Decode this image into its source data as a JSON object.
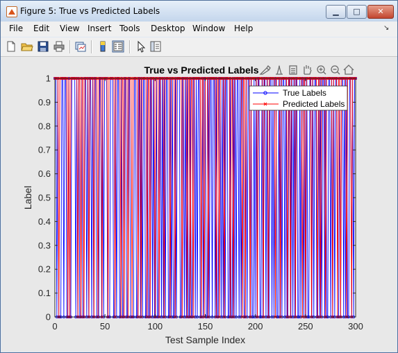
{
  "window": {
    "title": "Figure 5: True vs Predicted Labels",
    "controls": {
      "minimize": "▁",
      "maximize": "□",
      "close": "✕"
    }
  },
  "menu": {
    "items": [
      "File",
      "Edit",
      "View",
      "Insert",
      "Tools",
      "Desktop",
      "Window",
      "Help"
    ],
    "overflow": "↘"
  },
  "toolbar": {
    "icons": [
      "new-figure-icon",
      "open-file-icon",
      "save-icon",
      "print-icon",
      "link-plot-icon",
      "colorbar-icon",
      "legend-icon",
      "pointer-icon",
      "property-inspector-icon"
    ]
  },
  "axes_toolbar": {
    "icons": [
      "brush-icon",
      "data-tip-icon",
      "rotate-icon",
      "pan-icon",
      "zoom-in-icon",
      "zoom-out-icon",
      "home-icon"
    ]
  },
  "colors": {
    "true": "#0000ff",
    "predicted": "#ff0000"
  },
  "chart_data": {
    "type": "line",
    "title": "True vs Predicted Labels",
    "xlabel": "Test Sample Index",
    "ylabel": "Label",
    "xlim": [
      0,
      300
    ],
    "ylim": [
      0,
      1
    ],
    "xticks": [
      "0",
      "50",
      "100",
      "150",
      "200",
      "250",
      "300"
    ],
    "yticks": [
      "0",
      "0.1",
      "0.2",
      "0.3",
      "0.4",
      "0.5",
      "0.6",
      "0.7",
      "0.8",
      "0.9",
      "1"
    ],
    "grid": false,
    "legend_position": "top-right",
    "series": [
      {
        "name": "True Labels",
        "marker": "o",
        "color": "#0000ff",
        "values": [
          1,
          1,
          0,
          1,
          0,
          0,
          0,
          1,
          1,
          0,
          1,
          1,
          0,
          0,
          1,
          0,
          0,
          1,
          1,
          1,
          1,
          0,
          1,
          0,
          1,
          0,
          0,
          1,
          0,
          0,
          1,
          1,
          0,
          1,
          0,
          1,
          1,
          0,
          1,
          0,
          1,
          1,
          0,
          0,
          0,
          1,
          1,
          0,
          1,
          0,
          1,
          1,
          1,
          0,
          0,
          0,
          1,
          1,
          1,
          0,
          0,
          1,
          0,
          1,
          1,
          0,
          0,
          1,
          0,
          0,
          1,
          1,
          0,
          0,
          1,
          1,
          0,
          0,
          0,
          0,
          1,
          1,
          0,
          0,
          1,
          1,
          0,
          1,
          0,
          1,
          1,
          0,
          0,
          1,
          0,
          0,
          1,
          1,
          0,
          1,
          0,
          0,
          1,
          0,
          0,
          1,
          1,
          0,
          1,
          0,
          1,
          0,
          1,
          1,
          0,
          0,
          1,
          0,
          1,
          0,
          0,
          1,
          0,
          1,
          1,
          1,
          0,
          0,
          1,
          1,
          0,
          1,
          0,
          1,
          0,
          0,
          1,
          0,
          0,
          1,
          1,
          0,
          1,
          0,
          1,
          1,
          0,
          0,
          1,
          0,
          1,
          1,
          0,
          0,
          1,
          0,
          1,
          1,
          0,
          1,
          1,
          0,
          1,
          0,
          0,
          1,
          1,
          0,
          1,
          0,
          1,
          0,
          1,
          1,
          0,
          0,
          1,
          0,
          0,
          1,
          0,
          1,
          0,
          1,
          1,
          0,
          1,
          0,
          1,
          1,
          0,
          0,
          1,
          0,
          1,
          1,
          0,
          1,
          0,
          0,
          1,
          0,
          1,
          0,
          1,
          1,
          0,
          0,
          1,
          0,
          1,
          1,
          0,
          1,
          0,
          0,
          1,
          1,
          0,
          1,
          0,
          1,
          1,
          0,
          0,
          1,
          0,
          1,
          0,
          1,
          1,
          0,
          1,
          0,
          0,
          1,
          1,
          0,
          1,
          0,
          1,
          0,
          1,
          1,
          0,
          0,
          1,
          0,
          1,
          1,
          0,
          1,
          0,
          1,
          0,
          0,
          1,
          1,
          0,
          1,
          0,
          1,
          1,
          0,
          0,
          1,
          0,
          1,
          0,
          1,
          1,
          0,
          1,
          0,
          0,
          1,
          1,
          0,
          1,
          0,
          1,
          0,
          1,
          1,
          0,
          0,
          1,
          0,
          1,
          1,
          0,
          1,
          0,
          1,
          0,
          0,
          1,
          1,
          0,
          1,
          0,
          1,
          1
        ]
      },
      {
        "name": "Predicted Labels",
        "marker": "x",
        "color": "#ff0000",
        "values": [
          1,
          1,
          1,
          1,
          0,
          1,
          1,
          1,
          1,
          1,
          1,
          1,
          1,
          0,
          1,
          0,
          1,
          1,
          1,
          1,
          1,
          1,
          1,
          0,
          1,
          1,
          0,
          1,
          1,
          0,
          1,
          1,
          1,
          1,
          0,
          1,
          1,
          1,
          1,
          0,
          1,
          1,
          1,
          0,
          1,
          1,
          1,
          0,
          1,
          1,
          1,
          1,
          1,
          0,
          1,
          1,
          1,
          1,
          1,
          1,
          0,
          1,
          1,
          1,
          1,
          1,
          0,
          1,
          1,
          0,
          1,
          1,
          1,
          0,
          1,
          1,
          1,
          0,
          1,
          1,
          1,
          1,
          1,
          0,
          1,
          1,
          0,
          1,
          1,
          1,
          1,
          1,
          0,
          1,
          1,
          0,
          1,
          1,
          1,
          1,
          0,
          1,
          1,
          1,
          0,
          1,
          1,
          1,
          1,
          0,
          1,
          1,
          1,
          1,
          1,
          0,
          1,
          1,
          1,
          1,
          0,
          1,
          1,
          1,
          1,
          1,
          1,
          0,
          1,
          1,
          1,
          1,
          0,
          1,
          1,
          0,
          1,
          1,
          0,
          1,
          1,
          1,
          1,
          1,
          1,
          1,
          0,
          1,
          1,
          0,
          1,
          1,
          1,
          0,
          1,
          1,
          1,
          1,
          1,
          1,
          1,
          0,
          1,
          1,
          0,
          1,
          1,
          1,
          1,
          0,
          1,
          1,
          1,
          1,
          1,
          0,
          1,
          1,
          0,
          1,
          1,
          1,
          1,
          1,
          1,
          1,
          1,
          0,
          1,
          1,
          0,
          1,
          1,
          1,
          1,
          0,
          1,
          1,
          1,
          1,
          1,
          1,
          0,
          1,
          1,
          1,
          1,
          1,
          0,
          1,
          1,
          1,
          1,
          0,
          1,
          1,
          1,
          1,
          1,
          1,
          0,
          1,
          1,
          1,
          1,
          0,
          1,
          1,
          1,
          1,
          1,
          1,
          0,
          1,
          1,
          0,
          1,
          1,
          1,
          1,
          0,
          1,
          1,
          1,
          1,
          1,
          1,
          0,
          1,
          1,
          0,
          1,
          1,
          1,
          1,
          1,
          0,
          1,
          1,
          1,
          1,
          1,
          0,
          1,
          1,
          0,
          1,
          1,
          1,
          1,
          0,
          1,
          1,
          1,
          1,
          1,
          1,
          0,
          1,
          1,
          1,
          1,
          0,
          1,
          1,
          0,
          1,
          1,
          1,
          1,
          1,
          0,
          1,
          1,
          1,
          1,
          0,
          1,
          1,
          1,
          1
        ]
      }
    ]
  }
}
